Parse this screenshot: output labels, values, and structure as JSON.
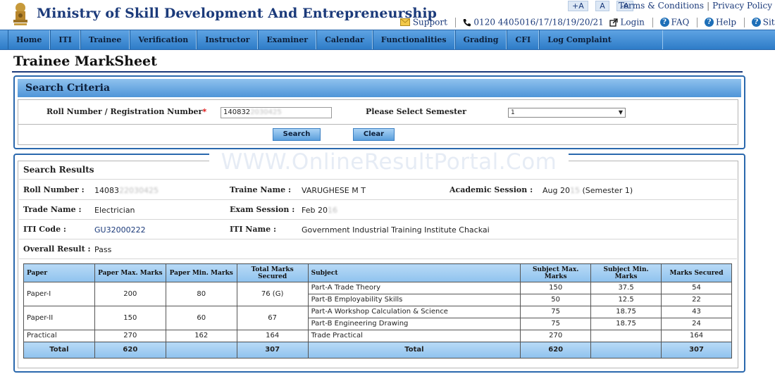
{
  "header": {
    "site_title": "Ministry of Skill Development And Entrepreneurship",
    "font_controls": [
      "+A",
      "A",
      "-A"
    ],
    "terms_link": "Terms & Conditions",
    "privacy_link": "Privacy Policy",
    "support_link": "Support",
    "phone": "0120 4405016/17/18/19/20/21",
    "login_link": "Login",
    "faq_link": "FAQ",
    "help_link": "Help",
    "sitemap_link": "SiteMap"
  },
  "nav": {
    "items": [
      "Home",
      "ITI",
      "Trainee",
      "Verification",
      "Instructor",
      "Examiner",
      "Calendar",
      "Functionalities",
      "Grading",
      "CFI",
      "Log Complaint"
    ]
  },
  "page": {
    "title": "Trainee MarkSheet"
  },
  "search_criteria": {
    "heading": "Search Criteria",
    "roll_label": "Roll Number / Registration Number",
    "required_mark": "*",
    "roll_value_visible": "140832",
    "roll_value_blurred": "2030425",
    "semester_label": "Please Select Semester",
    "semester_selected": "1",
    "search_button": "Search",
    "clear_button": "Clear"
  },
  "watermark": "WWW.OnlineResultPortal.Com",
  "results": {
    "heading": "Search Results",
    "roll_label": "Roll Number :",
    "roll_visible": "14083",
    "roll_blurred": "22030425",
    "trainee_label": "Traine Name :",
    "trainee_value": "VARUGHESE M T",
    "session_label": "Academic Session :",
    "session_prefix": "Aug 20",
    "session_blurred": "15",
    "session_suffix": " (Semester 1)",
    "trade_label": "Trade Name :",
    "trade_value": "Electrician",
    "exam_label": "Exam Session :",
    "exam_prefix": "Feb 20",
    "exam_blurred": "16",
    "iti_code_label": "ITI Code :",
    "iti_code_value": "GU32000222",
    "iti_name_label": "ITI Name :",
    "iti_name_value": "Government Industrial Training Institute Chackai",
    "overall_label": "Overall Result :",
    "overall_value": "Pass"
  },
  "marks_table": {
    "headers": [
      "Paper",
      "Paper Max. Marks",
      "Paper Min. Marks",
      "Total Marks Secured",
      "Subject",
      "Subject Max. Marks",
      "Subject Min. Marks",
      "Marks Secured"
    ],
    "papers": [
      {
        "paper": "Paper-I",
        "max": "200",
        "min": "80",
        "secured": "76 (G)",
        "subjects": [
          {
            "name": "Part-A Trade Theory",
            "max": "150",
            "min": "37.5",
            "secured": "54"
          },
          {
            "name": "Part-B Employability Skills",
            "max": "50",
            "min": "12.5",
            "secured": "22"
          }
        ]
      },
      {
        "paper": "Paper-II",
        "max": "150",
        "min": "60",
        "secured": "67",
        "subjects": [
          {
            "name": "Part-A Workshop Calculation & Science",
            "max": "75",
            "min": "18.75",
            "secured": "43"
          },
          {
            "name": "Part-B Engineering Drawing",
            "max": "75",
            "min": "18.75",
            "secured": "24"
          }
        ]
      },
      {
        "paper": "Practical",
        "max": "270",
        "min": "162",
        "secured": "164",
        "subjects": [
          {
            "name": "Trade Practical",
            "max": "270",
            "min": "",
            "secured": "164"
          }
        ]
      }
    ],
    "total_row": {
      "label": "Total",
      "paper_max": "620",
      "paper_secured": "307",
      "subject_label": "Total",
      "subject_max": "620",
      "secured": "307"
    }
  },
  "colors": {
    "nav_blue": "#2e7cc8",
    "title_navy": "#1b3a7a",
    "header_light_blue": "#8fc2ee"
  }
}
